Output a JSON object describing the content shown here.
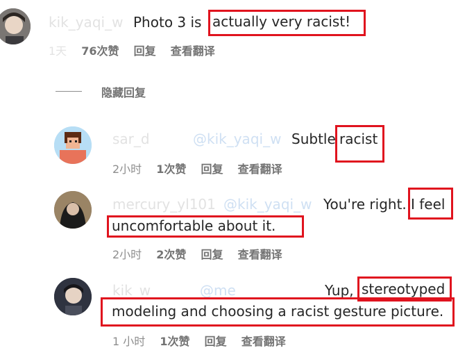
{
  "comments": [
    {
      "username": "kik_yaqi_w",
      "text_before": " Photo 3 is ",
      "highlight": "actually very racist!",
      "time": "1天",
      "likes": "76次赞",
      "reply": "回复",
      "translate": "查看翻译"
    }
  ],
  "hide_replies": "隐藏回复",
  "replies": [
    {
      "username": "sar_d",
      "mention": "@kik_yaqi_w",
      "text_before": "Subtle ",
      "highlight": "racist",
      "time": "2小时",
      "likes": "1次赞",
      "reply": "回复",
      "translate": "查看翻译"
    },
    {
      "username": "mercury_yl101",
      "mention": "@kik_yaqi_w",
      "text_before": "You're right. ",
      "highlight1": "I feel",
      "highlight2": "uncomfortable about it.",
      "time": "2小时",
      "likes": "2次赞",
      "reply": "回复",
      "translate": "查看翻译"
    },
    {
      "username": "kik_w",
      "mention": "@me",
      "text_before": "Yup, ",
      "highlight1": "stereotyped",
      "highlight2": "modeling and choosing a racist gesture picture.",
      "time": "1 小时",
      "likes": "1次赞",
      "reply": "回复",
      "translate": "查看翻译"
    }
  ],
  "colors": {
    "highlight_border": "#e0131e",
    "meta": "#8e8e8e",
    "text": "#262626"
  }
}
